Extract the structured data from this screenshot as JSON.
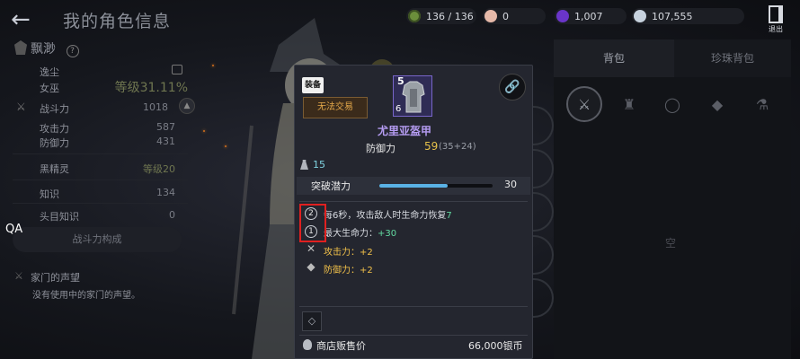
{
  "header": {
    "title": "我的角色信息",
    "exit_label": "退出"
  },
  "resources": {
    "fatigue": "136 / 136",
    "pearl": "0",
    "gem": "1,007",
    "silver": "107,555"
  },
  "character": {
    "name": "飘渺",
    "sub_name": "逸尘",
    "zodiac": "女巫",
    "level_text": "等级31.11%",
    "combat_power_label": "战斗力",
    "combat_power": "1018",
    "attack_label": "攻击力",
    "attack": "587",
    "defense_label": "防御力",
    "defense": "431",
    "spirit_label": "黑精灵",
    "spirit_level": "等级20",
    "knowledge_label": "知识",
    "knowledge": "134",
    "head_label": "头目知识",
    "head_value": "0",
    "cp_build_button": "战斗力构成",
    "reputation_title": "家门的声望",
    "reputation_desc": "没有使用中的家门的声望。"
  },
  "overlay_label": "QA",
  "right_panel": {
    "tab_bag": "背包",
    "tab_jewel": "珍珠背包",
    "empty_text": "空",
    "filters": [
      "weapon-icon",
      "armor-icon",
      "necklace-icon",
      "gem-icon",
      "potion-icon"
    ]
  },
  "item": {
    "equip_tag": "装备",
    "trade_status": "无法交易",
    "enhance_level": "5",
    "count": "6",
    "name": "尤里亚盔甲",
    "defense_label": "防御力",
    "defense_value": "59",
    "defense_extra": "(35+24)",
    "weight": "15",
    "breakthrough_label": "突破潜力",
    "breakthrough_value": "30",
    "breakthrough_fraction": 0.6,
    "effects": [
      {
        "icon_text": "2",
        "text_before": "每6秒，攻击敌人时生命力恢复",
        "num": "7"
      },
      {
        "icon_text": "1",
        "text_before": "最大生命力：",
        "num": "+30"
      },
      {
        "icon_text": "✕",
        "text_before": "攻击力：+2",
        "num": ""
      },
      {
        "icon_text": "◆",
        "text_before": "防御力：+2",
        "num": ""
      }
    ],
    "shop_price_label": "商店贩售价",
    "shop_price_value": "66,000银币"
  },
  "colors": {
    "item_name": "#b59cf2",
    "defense_value": "#e6c14a",
    "bonus_green": "#62d9a0",
    "trade_orange": "#e4a84a",
    "highlight_red": "#e02020"
  }
}
